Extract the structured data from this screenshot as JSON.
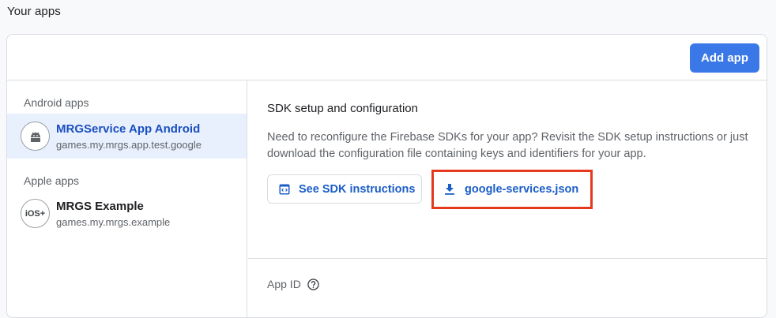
{
  "section_title": "Your apps",
  "header": {
    "add_app_label": "Add app"
  },
  "sidebar": {
    "android_group_label": "Android apps",
    "android_apps": [
      {
        "name": "MRGService App Android",
        "package": "games.my.mrgs.app.test.google",
        "icon": "android-icon",
        "selected": true
      }
    ],
    "apple_group_label": "Apple apps",
    "apple_apps": [
      {
        "name": "MRGS Example",
        "package": "games.my.mrgs.example",
        "icon": "ios-icon",
        "icon_text": "iOS+",
        "selected": false
      }
    ]
  },
  "main": {
    "sdk_title": "SDK setup and configuration",
    "sdk_description": "Need to reconfigure the Firebase SDKs for your app? Revisit the SDK setup instructions or just download the configuration file containing keys and identifiers for your app.",
    "see_sdk_label": "See SDK instructions",
    "download_json_label": "google-services.json",
    "app_id_label": "App ID"
  },
  "colors": {
    "accent": "#1a73e8",
    "highlight_border": "#e5391e",
    "selected_bg": "#e8f0fe"
  }
}
